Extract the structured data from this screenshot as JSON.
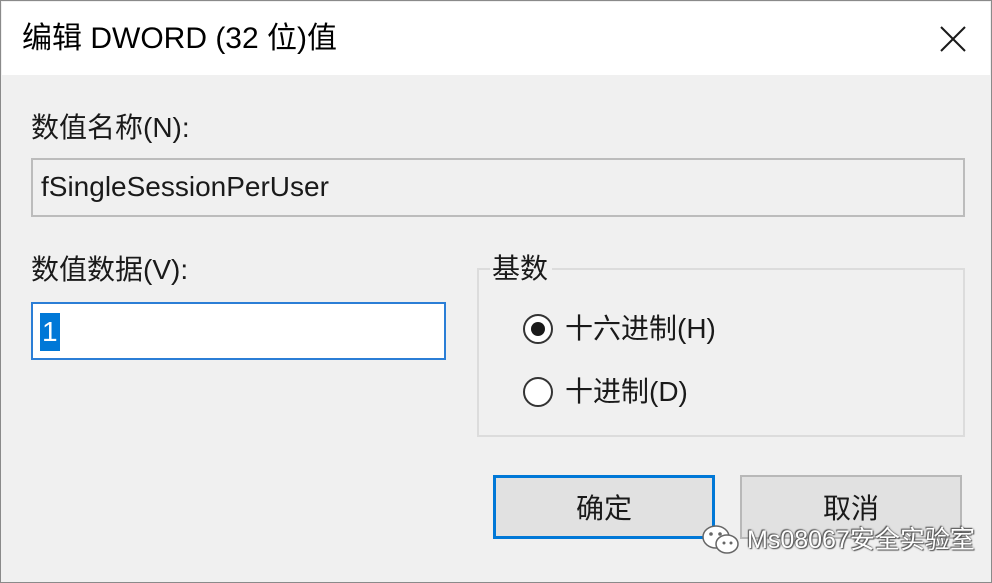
{
  "window": {
    "title": "编辑 DWORD (32 位)值",
    "close_icon": "close-icon"
  },
  "value_name": {
    "label": "数值名称(N):",
    "value": "fSingleSessionPerUser"
  },
  "value_data": {
    "label": "数值数据(V):",
    "value": "1"
  },
  "base": {
    "title": "基数",
    "options": [
      {
        "label": "十六进制(H)",
        "selected": true
      },
      {
        "label": "十进制(D)",
        "selected": false
      }
    ]
  },
  "buttons": {
    "ok_label": "确定",
    "cancel_label": "取消"
  },
  "watermark": {
    "text": "Ms08067安全实验室",
    "icon": "wechat-icon"
  },
  "colors": {
    "accent": "#0078d7",
    "window_bg": "#f0f0f0",
    "titlebar_bg": "#ffffff"
  }
}
